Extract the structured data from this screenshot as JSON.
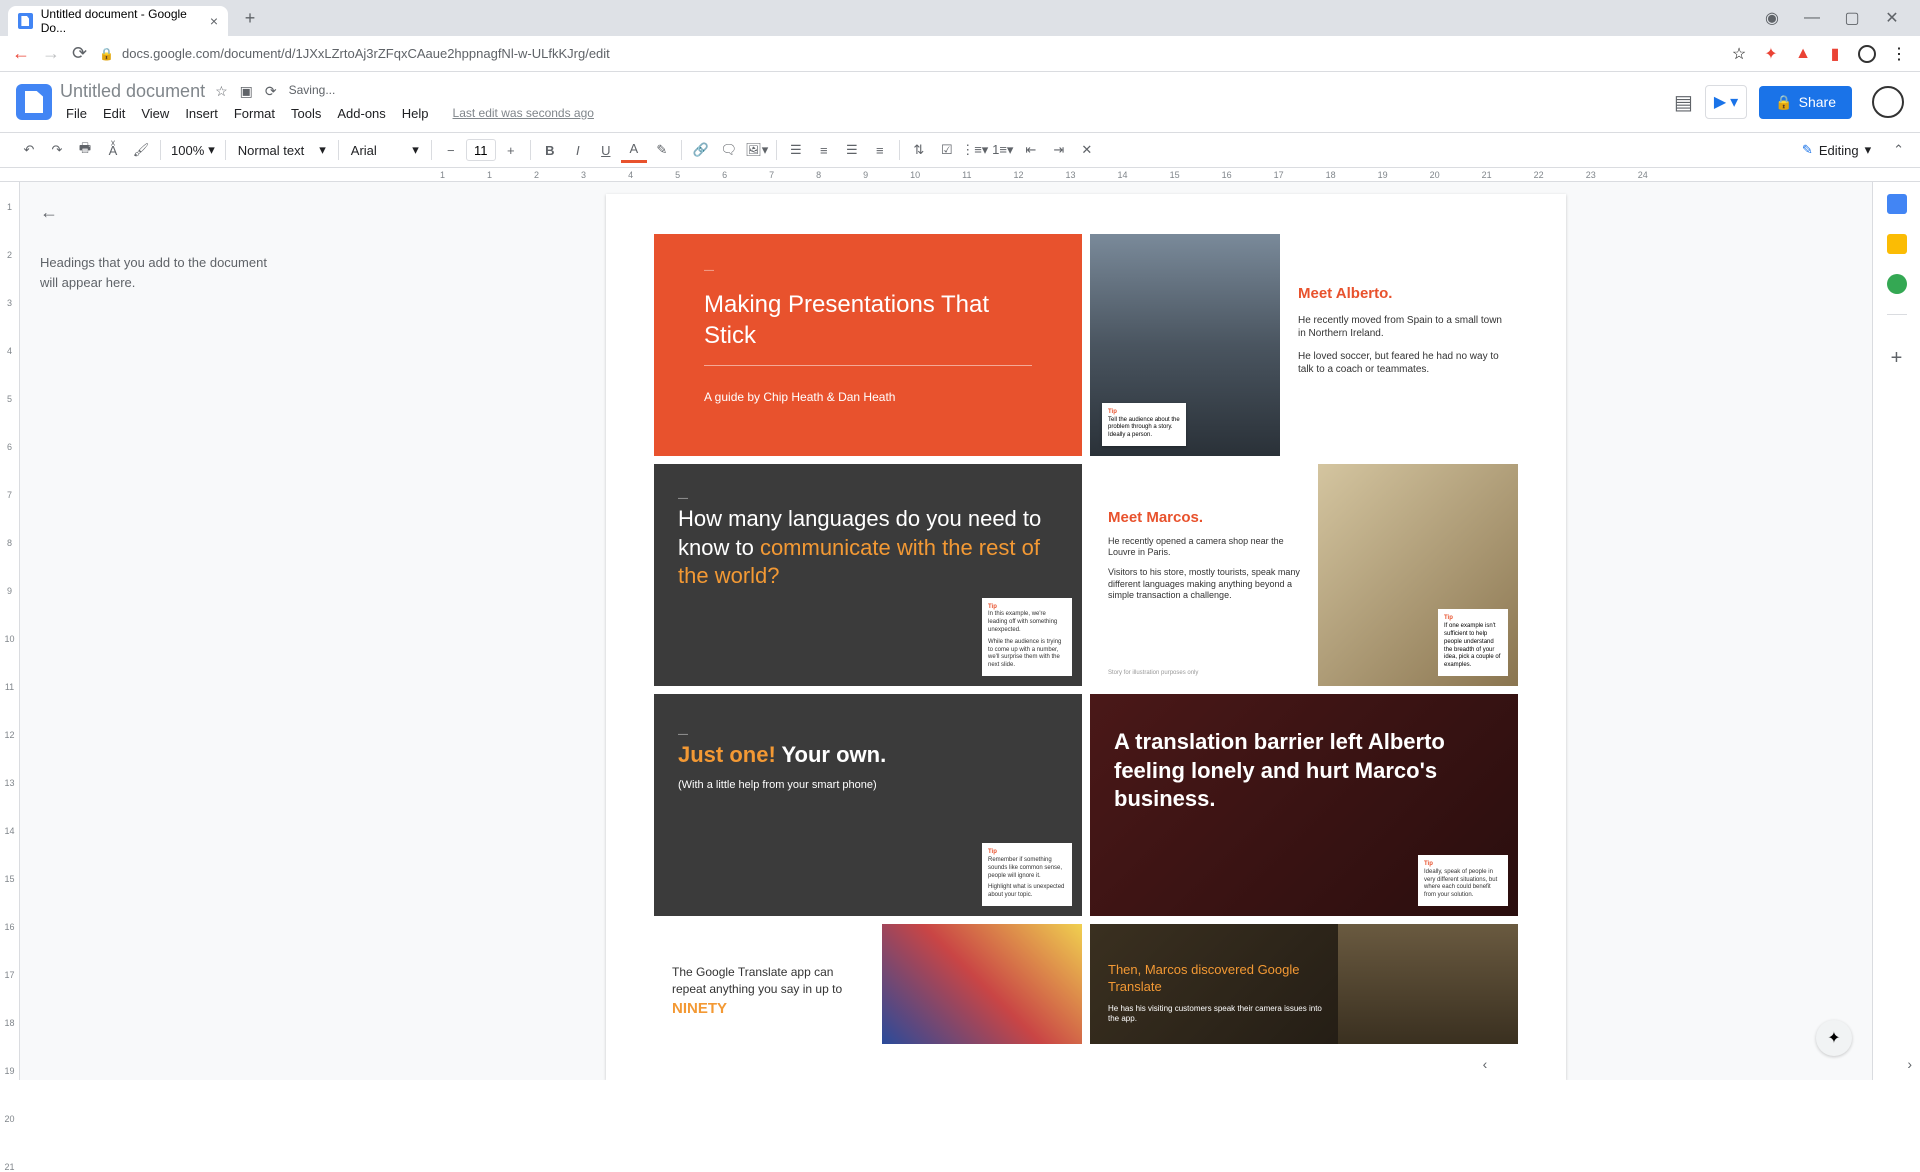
{
  "browser": {
    "tab_title": "Untitled document - Google Do...",
    "url": "docs.google.com/document/d/1JXxLZrtoAj3rZFqxCAaue2hppnagfNl-w-ULfkKJrg/edit"
  },
  "header": {
    "doc_title": "Untitled document",
    "saving": "Saving...",
    "last_edit": "Last edit was seconds ago",
    "share": "Share"
  },
  "menus": {
    "file": "File",
    "edit": "Edit",
    "view": "View",
    "insert": "Insert",
    "format": "Format",
    "tools": "Tools",
    "addons": "Add-ons",
    "help": "Help"
  },
  "toolbar": {
    "zoom": "100%",
    "style": "Normal text",
    "font": "Arial",
    "size": "11",
    "editing": "Editing"
  },
  "outline": {
    "placeholder": "Headings that you add to the document will appear here."
  },
  "ruler": {
    "marks": [
      "1",
      "1",
      "2",
      "3",
      "4",
      "5",
      "6",
      "7",
      "8",
      "9",
      "10",
      "11",
      "12",
      "13",
      "14",
      "15",
      "16",
      "17",
      "18",
      "19",
      "20",
      "21",
      "22",
      "23",
      "24"
    ]
  },
  "vruler": {
    "marks": [
      "1",
      "2",
      "3",
      "4",
      "5",
      "6",
      "7",
      "8",
      "9",
      "10",
      "11",
      "12",
      "13",
      "14",
      "15",
      "16",
      "17",
      "18",
      "19",
      "20",
      "21"
    ]
  },
  "slides": {
    "s1": {
      "title": "Making Presentations That Stick",
      "byline": "A guide by Chip Heath & Dan Heath"
    },
    "s2": {
      "heading": "Meet Alberto.",
      "p1": "He recently moved from Spain to a small town in Northern Ireland.",
      "p2": "He loved soccer, but feared he had no way to talk to a coach or teammates.",
      "tip_label": "Tip",
      "tip_text": "Tell the audience about the problem through a story. Ideally a person."
    },
    "s3": {
      "line1": "How many languages do you need to know to ",
      "line2": "communicate with the rest of the world?",
      "tip_label": "Tip",
      "tip_text1": "In this example, we're leading off with something unexpected.",
      "tip_text2": "While the audience is trying to come up with a number, we'll surprise them with the next slide."
    },
    "s4": {
      "heading": "Meet Marcos.",
      "p1": "He recently opened a camera shop near the Louvre in Paris.",
      "p2": "Visitors to his store, mostly tourists, speak many different languages making anything beyond a simple transaction a challenge.",
      "disclaimer": "Story for illustration purposes only",
      "tip_label": "Tip",
      "tip_text": "If one example isn't sufficient to help people understand the breadth of your idea, pick a couple of examples."
    },
    "s5": {
      "highlight": "Just one!",
      "rest": " Your own.",
      "sub": "(With a little help from your smart phone)",
      "tip_label": "Tip",
      "tip_text1": "Remember if something sounds like common sense, people will ignore it.",
      "tip_text2": "Highlight what is unexpected about your topic."
    },
    "s6": {
      "title": "A translation barrier left Alberto feeling lonely and hurt Marco's business.",
      "tip_label": "Tip",
      "tip_text": "Ideally, speak of people in very different situations, but where each could benefit from your solution."
    },
    "s7": {
      "text": "The Google Translate app can repeat anything you say in up to ",
      "highlight": "NINETY"
    },
    "s8": {
      "heading": "Then, Marcos discovered Google Translate",
      "p": "He has his visiting customers speak their camera issues into the app."
    }
  }
}
